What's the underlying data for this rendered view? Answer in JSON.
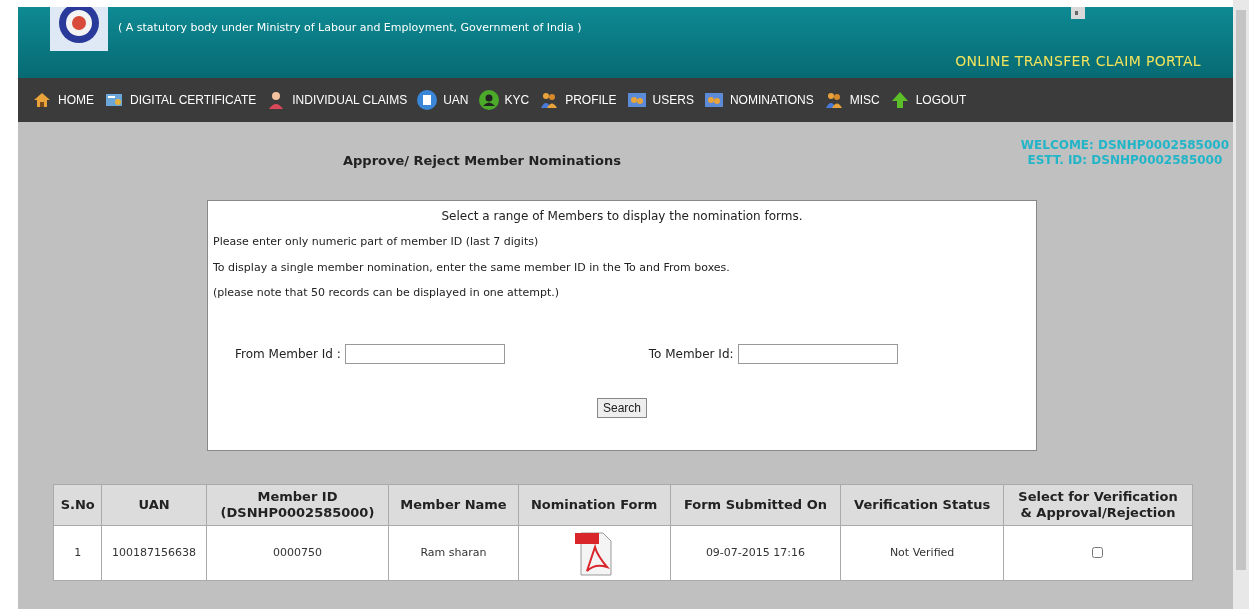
{
  "header": {
    "subtitle": "( A statutory body under Ministry of Labour and Employment, Government of India )",
    "portal": "ONLINE TRANSFER CLAIM PORTAL"
  },
  "nav": [
    {
      "label": "HOME",
      "kind": "home"
    },
    {
      "label": "DIGITAL CERTIFICATE",
      "kind": "certificate"
    },
    {
      "label": "INDIVIDUAL CLAIMS",
      "kind": "person"
    },
    {
      "label": "UAN",
      "kind": "document"
    },
    {
      "label": "KYC",
      "kind": "user"
    },
    {
      "label": "PROFILE",
      "kind": "people"
    },
    {
      "label": "USERS",
      "kind": "group"
    },
    {
      "label": "NOMINATIONS",
      "kind": "group"
    },
    {
      "label": "MISC",
      "kind": "people"
    },
    {
      "label": "LOGOUT",
      "kind": "arrow"
    }
  ],
  "page_title": "Approve/ Reject Member Nominations",
  "welcome": "WELCOME: DSNHP0002585000",
  "estt": "ESTT. ID: DSNHP0002585000",
  "form": {
    "heading": "Select a range of Members to display the nomination forms.",
    "notes": [
      "Please enter only numeric part of member ID (last 7 digits)",
      "To display a single member nomination, enter the same member ID in the To and From boxes.",
      "(please note that 50 records can be displayed in one attempt.)"
    ],
    "from_label": "From Member Id :",
    "to_label": "To Member Id:",
    "search_button": "Search"
  },
  "table": {
    "columns": [
      "S.No",
      "UAN",
      "Member ID\n(DSNHP0002585000)",
      "Member Name",
      "Nomination Form",
      "Form Submitted On",
      "Verification Status",
      "Select for Verification\n& Approval/Rejection"
    ],
    "rows": [
      {
        "sno": "1",
        "uan": "100187156638",
        "member_id": "0000750",
        "name": "Ram sharan",
        "submitted": "09-07-2015 17:16",
        "status": "Not Verified",
        "checked": false
      }
    ]
  }
}
